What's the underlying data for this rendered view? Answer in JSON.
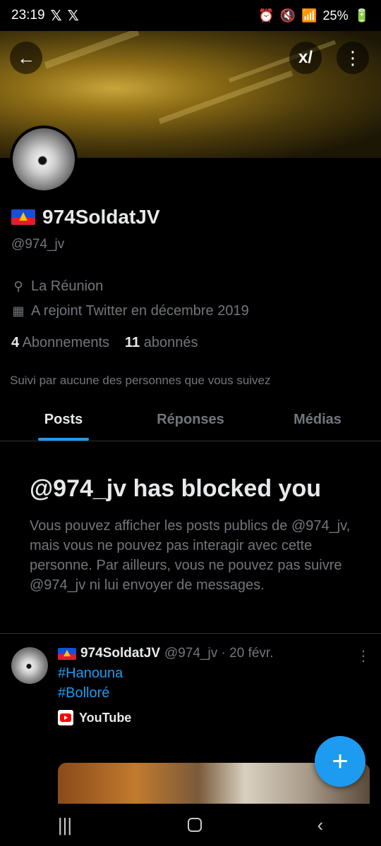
{
  "status_bar": {
    "time": "23:19",
    "notif_icons": [
      "𝕏",
      "𝕏"
    ],
    "battery": "25%"
  },
  "header": {
    "back_icon": "arrow-left-icon",
    "grok_label": "x/",
    "more_icon": "more-vertical-icon"
  },
  "profile": {
    "display_name": "974SoldatJV",
    "handle": "@974_jv",
    "location": "La Réunion",
    "joined": "A rejoint Twitter en décembre 2019",
    "following_count": "4",
    "following_label": "Abonnements",
    "followers_count": "11",
    "followers_label": "abonnés",
    "followed_by": "Suivi par aucune des personnes que vous suivez"
  },
  "tabs": [
    {
      "label": "Posts",
      "active": true
    },
    {
      "label": "Réponses",
      "active": false
    },
    {
      "label": "Médias",
      "active": false
    }
  ],
  "blocked": {
    "title": "@974_jv has blocked you",
    "body": "Vous pouvez afficher les posts publics de @974_jv, mais vous ne pouvez pas interagir avec cette personne. Par ailleurs, vous ne pouvez pas suivre @974_jv ni lui envoyer de messages."
  },
  "tweet": {
    "name": "974SoldatJV",
    "meta": "@974_jv · 20 févr.",
    "hashtags": [
      "#Hanouna",
      "#Bolloré"
    ],
    "link_source": "YouTube"
  },
  "fab_label": "+",
  "colors": {
    "accent": "#1d9bf0",
    "muted": "#71767b",
    "text": "#e7e9ea",
    "background": "#000000"
  }
}
